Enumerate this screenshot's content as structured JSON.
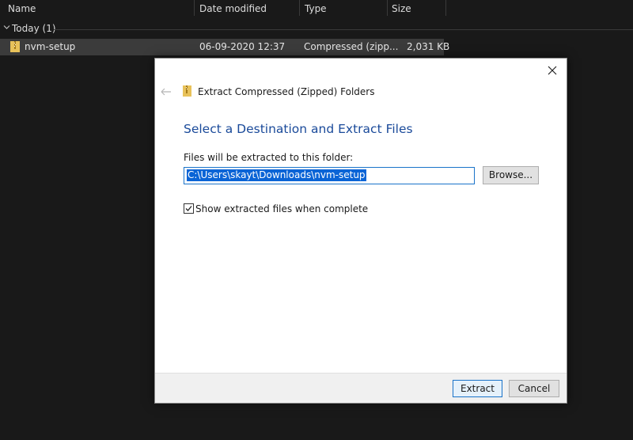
{
  "explorer": {
    "columns": [
      "Name",
      "Date modified",
      "Type",
      "Size"
    ],
    "group": "Today (1)",
    "file": {
      "name": "nvm-setup",
      "date": "06-09-2020 12:37",
      "type": "Compressed (zipp...",
      "size": "2,031 KB"
    }
  },
  "dialog": {
    "title": "Extract Compressed (Zipped) Folders",
    "heading": "Select a Destination and Extract Files",
    "folder_label": "Files will be extracted to this folder:",
    "path": "C:\\Users\\skayt\\Downloads\\nvm-setup",
    "browse_label": "Browse...",
    "show_files_label": "Show extracted files when complete",
    "show_files_checked": true,
    "extract_label": "Extract",
    "cancel_label": "Cancel"
  },
  "colors": {
    "heading": "#1a4a9a",
    "selection": "#0a64d6",
    "explorer_bg": "#191919"
  }
}
